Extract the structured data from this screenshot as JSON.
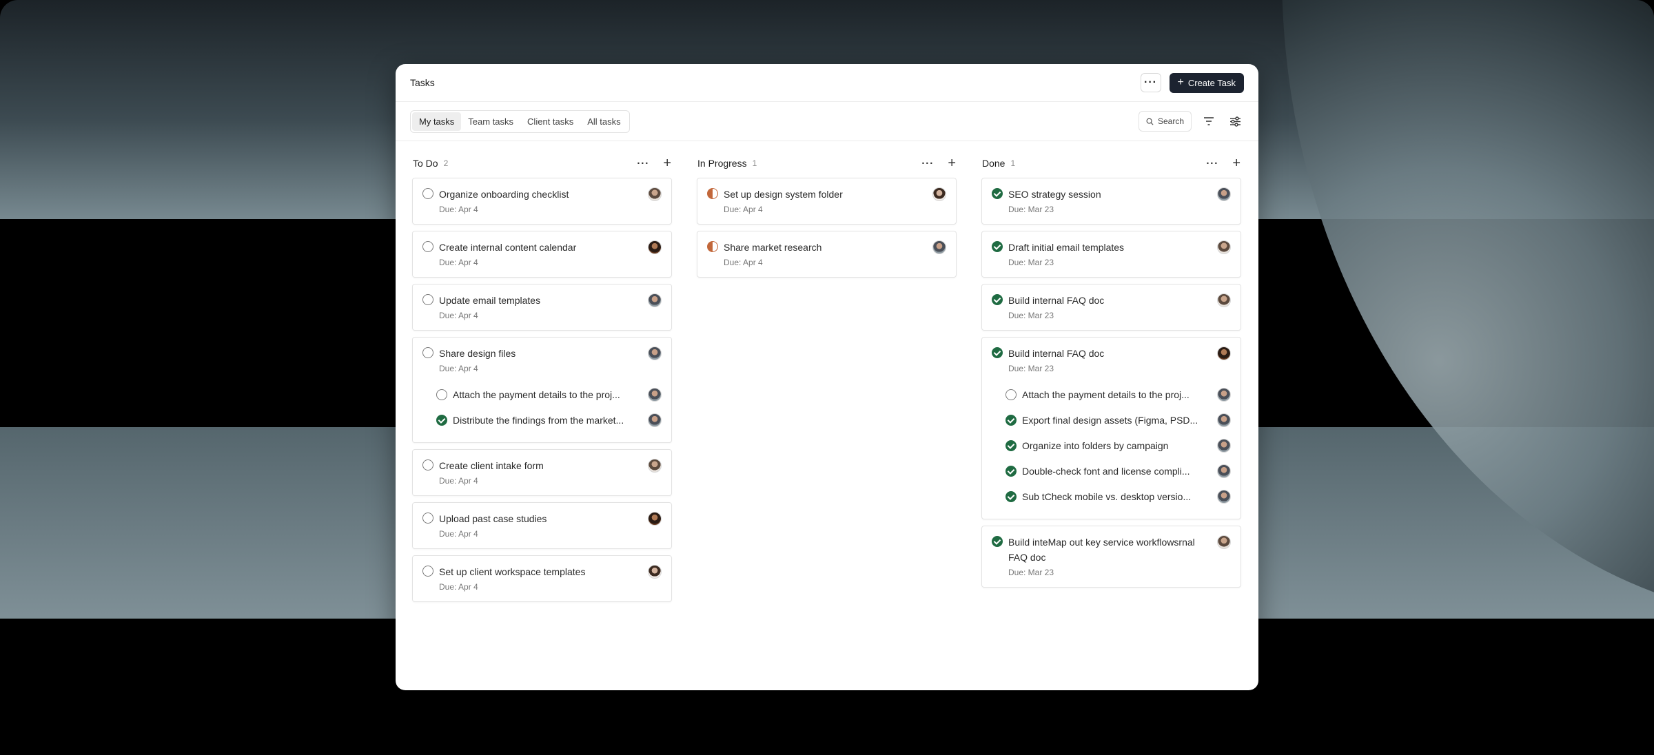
{
  "header": {
    "title": "Tasks",
    "more_label": "···",
    "create_label": "Create Task"
  },
  "tabs": [
    {
      "label": "My tasks",
      "active": true
    },
    {
      "label": "Team tasks",
      "active": false
    },
    {
      "label": "Client tasks",
      "active": false
    },
    {
      "label": "All tasks",
      "active": false
    }
  ],
  "toolbar": {
    "search_label": "Search",
    "filter_icon": "filter-icon",
    "settings_icon": "sliders-icon"
  },
  "colors": {
    "done_green": "#1f6b42",
    "progress_orange": "#c2673a",
    "primary_button": "#1c2330"
  },
  "columns": [
    {
      "title": "To Do",
      "count": "2",
      "cards": [
        {
          "title": "Organize onboarding checklist",
          "due": "Due: Apr 4",
          "status": "todo",
          "avatar": "av1"
        },
        {
          "title": "Create internal content calendar",
          "due": "Due: Apr 4",
          "status": "todo",
          "avatar": "av2"
        },
        {
          "title": "Update email templates",
          "due": "Due: Apr 4",
          "status": "todo",
          "avatar": "av3"
        },
        {
          "title": "Share design files",
          "due": "Due: Apr 4",
          "status": "todo",
          "avatar": "av3",
          "subtasks": [
            {
              "title": "Attach the payment details to the proj...",
              "status": "todo",
              "avatar": "av3"
            },
            {
              "title": "Distribute the findings from the market...",
              "status": "done",
              "avatar": "av3"
            }
          ]
        },
        {
          "title": "Create client intake form",
          "due": "Due: Apr 4",
          "status": "todo",
          "avatar": "av1"
        },
        {
          "title": "Upload past case studies",
          "due": "Due: Apr 4",
          "status": "todo",
          "avatar": "av2"
        },
        {
          "title": "Set up client workspace templates",
          "due": "Due: Apr 4",
          "status": "todo",
          "avatar": "av4"
        }
      ]
    },
    {
      "title": "In Progress",
      "count": "1",
      "cards": [
        {
          "title": "Set up design system folder",
          "due": "Due: Apr 4",
          "status": "progress",
          "avatar": "av4"
        },
        {
          "title": "Share market research",
          "due": "Due: Apr 4",
          "status": "progress",
          "avatar": "av3"
        }
      ]
    },
    {
      "title": "Done",
      "count": "1",
      "cards": [
        {
          "title": "SEO strategy session",
          "due": "Due: Mar 23",
          "status": "done",
          "avatar": "av3"
        },
        {
          "title": "Draft initial email templates",
          "due": "Due: Mar 23",
          "status": "done",
          "avatar": "av1"
        },
        {
          "title": "Build internal FAQ doc",
          "due": "Due: Mar 23",
          "status": "done",
          "avatar": "av1"
        },
        {
          "title": "Build internal FAQ doc",
          "due": "Due: Mar 23",
          "status": "done",
          "avatar": "av2",
          "subtasks": [
            {
              "title": "Attach the payment details to the proj...",
              "status": "todo",
              "avatar": "av3"
            },
            {
              "title": "Export final design assets (Figma, PSD...",
              "status": "done",
              "avatar": "av3"
            },
            {
              "title": "Organize into folders by campaign",
              "status": "done",
              "avatar": "av3"
            },
            {
              "title": "Double-check font and license compli...",
              "status": "done",
              "avatar": "av3"
            },
            {
              "title": "Sub tCheck mobile vs. desktop versio...",
              "status": "done",
              "avatar": "av3"
            }
          ]
        },
        {
          "title": "Build inteMap out key service workflowsrnal FAQ doc",
          "due": "Due: Mar 23",
          "status": "done",
          "avatar": "av1"
        }
      ]
    }
  ]
}
